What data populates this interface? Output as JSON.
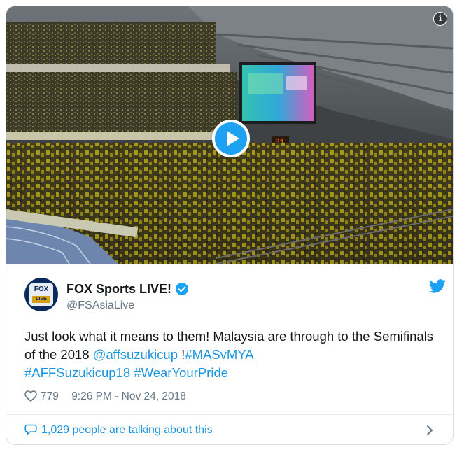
{
  "media": {
    "info_icon": "info-icon",
    "play_icon": "play-icon",
    "scoreboard_number": "81"
  },
  "account": {
    "name": "FOX Sports LIVE!",
    "handle": "@FSAsiaLive",
    "avatar_text_top": "FOX",
    "avatar_text_bottom": "LIVE",
    "verified_icon": "verified-badge-icon",
    "brand_icon": "twitter-bird-icon"
  },
  "tweet": {
    "text_part1": "Just look what it means to them! Malaysia are through to the Semifinals of the 2018 ",
    "mention": "@affsuzukicup",
    "text_part2": " !",
    "hashtag1": "#MASvMYA",
    "hashtag2": "#AFFSuzukicup18",
    "hashtag3": "#WearYourPride"
  },
  "meta": {
    "likes": "779",
    "timestamp": "9:26 PM - Nov 24, 2018"
  },
  "footer": {
    "talking_text": "1,029 people are talking about this"
  },
  "colors": {
    "accent": "#1da1f2",
    "link": "#1b95e0",
    "secondary_text": "#657786",
    "crowd_yellow": "#d9c21a"
  }
}
